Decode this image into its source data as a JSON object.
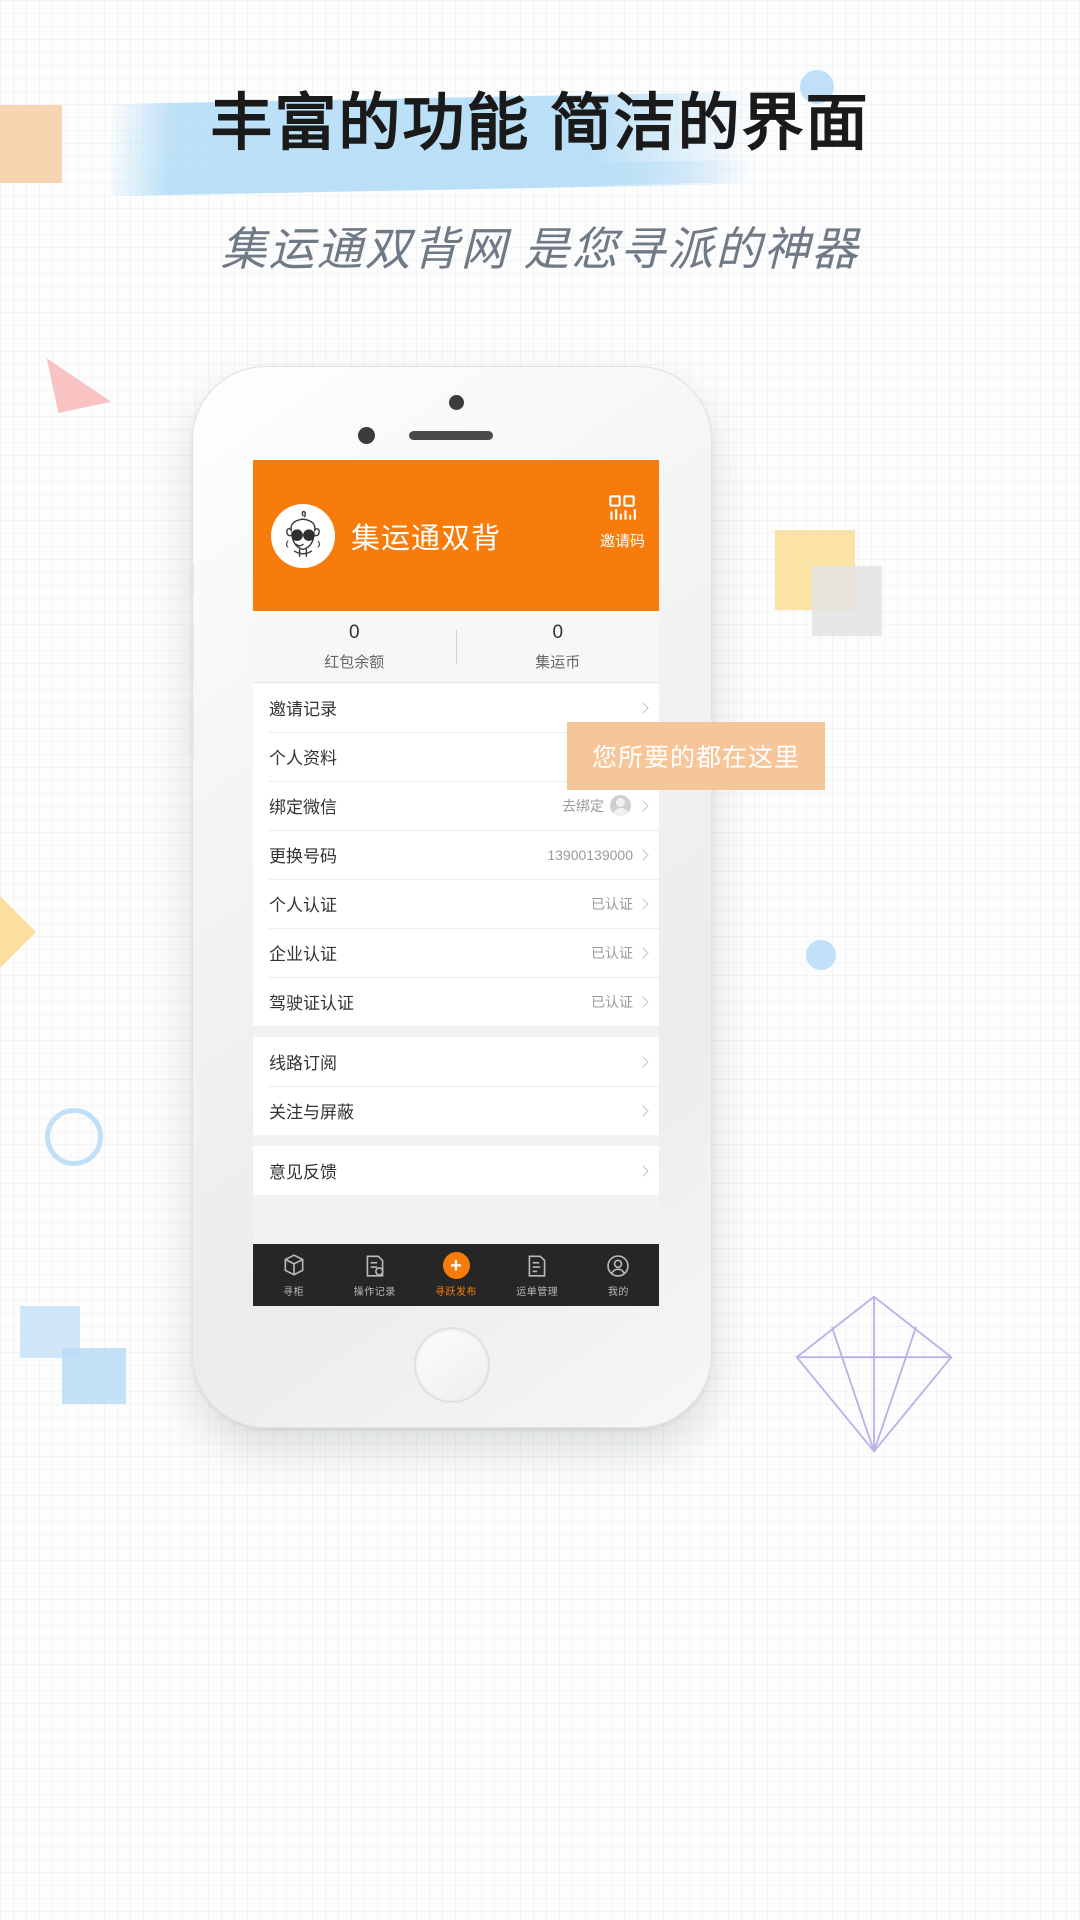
{
  "poster": {
    "headline": "丰富的功能 简洁的界面",
    "subtitle": "集运通双背网 是您寻派的神器",
    "callout": "您所要的都在这里",
    "accent_color": "#f87c0c",
    "brush_color": "#b2dcf6",
    "callout_bg": "#f7c59a"
  },
  "app": {
    "header": {
      "title": "集运通双背",
      "logo_icon": "mascot-sunglasses-icon",
      "invite": {
        "icon": "qr-code-icon",
        "label": "邀请码"
      }
    },
    "stats": [
      {
        "value": "0",
        "label": "红包余额"
      },
      {
        "value": "0",
        "label": "集运币"
      }
    ],
    "groups": [
      {
        "rows": [
          {
            "label": "邀请记录",
            "value": "",
            "avatar": false
          },
          {
            "label": "个人资料",
            "value": "",
            "avatar": false
          },
          {
            "label": "绑定微信",
            "value": "去绑定",
            "avatar": true
          },
          {
            "label": "更换号码",
            "value": "13900139000",
            "avatar": false
          },
          {
            "label": "个人认证",
            "value": "已认证",
            "avatar": false
          },
          {
            "label": "企业认证",
            "value": "已认证",
            "avatar": false
          },
          {
            "label": "驾驶证认证",
            "value": "已认证",
            "avatar": false
          }
        ]
      },
      {
        "rows": [
          {
            "label": "线路订阅",
            "value": "",
            "avatar": false
          },
          {
            "label": "关注与屏蔽",
            "value": "",
            "avatar": false
          }
        ]
      },
      {
        "rows": [
          {
            "label": "意见反馈",
            "value": "",
            "avatar": false
          }
        ]
      }
    ],
    "tabs": [
      {
        "label": "寻柜",
        "icon": "container-icon",
        "center": false
      },
      {
        "label": "操作记录",
        "icon": "record-icon",
        "center": false
      },
      {
        "label": "寻跃发布",
        "icon": "plus-icon",
        "center": true
      },
      {
        "label": "运单管理",
        "icon": "waybill-icon",
        "center": false
      },
      {
        "label": "我的",
        "icon": "user-icon",
        "center": false
      }
    ]
  }
}
